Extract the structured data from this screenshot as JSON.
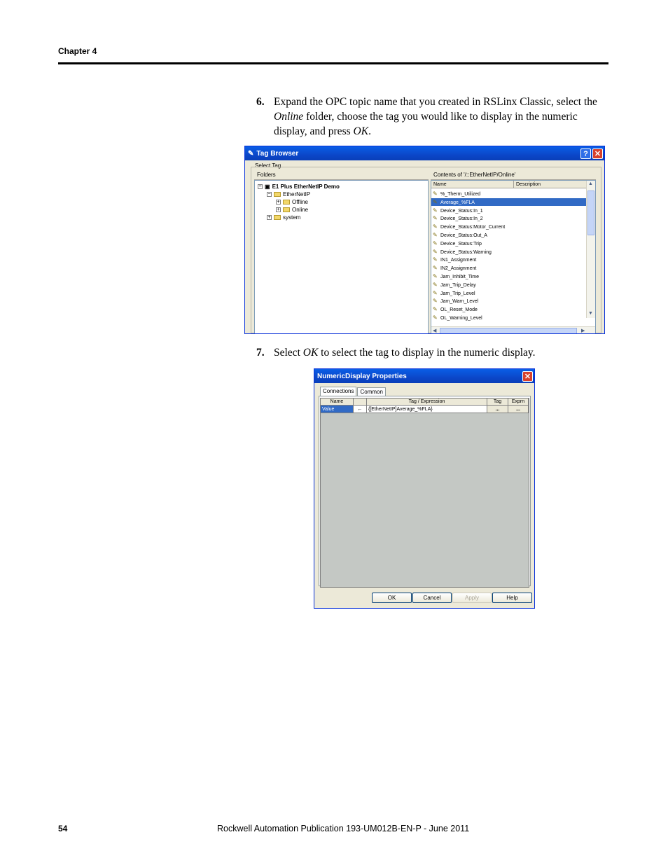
{
  "header": {
    "chapter": "Chapter 4"
  },
  "steps": [
    {
      "number": "6.",
      "text_parts": [
        "Expand the OPC topic name that you created in RSLinx Classic, select the ",
        "Online",
        " folder, choose the tag you would like to display in the numeric display, and press ",
        "OK",
        "."
      ]
    },
    {
      "number": "7.",
      "text_parts": [
        "Select ",
        "OK",
        " to select the tag to display in the numeric display."
      ]
    }
  ],
  "tag_browser": {
    "title": "Tag Browser",
    "help_label": "?",
    "close_label": "✕",
    "select_tag_label": "Select Tag",
    "folders_label": "Folders",
    "contents_label": "Contents of '/::EtherNetIP/Online'",
    "columns": [
      "Name",
      "Description"
    ],
    "tree": [
      {
        "label": "E1 Plus EtherNetIP Demo",
        "exp": "−"
      },
      {
        "label": "EtherNetIP",
        "exp": "−"
      },
      {
        "label": "Offline",
        "exp": "+"
      },
      {
        "label": "Online",
        "exp": "+"
      },
      {
        "label": "system",
        "exp": "+"
      }
    ],
    "tags": [
      "%_Therm_Utilized",
      "Average_%FLA",
      "Device_Status:In_1",
      "Device_Status:In_2",
      "Device_Status:Motor_Current",
      "Device_Status:Out_A",
      "Device_Status:Trip",
      "Device_Status:Warning",
      "IN1_Assignment",
      "IN2_Assignment",
      "Jam_Inhibit_Time",
      "Jam_Trip_Delay",
      "Jam_Trip_Level",
      "Jam_Warn_Level",
      "OL_Reset_Mode",
      "OL_Warning_Level"
    ],
    "selected_tag": "Average_%FLA"
  },
  "numeric_display": {
    "title": "NumericDisplay Properties",
    "close_label": "✕",
    "tabs": [
      "Connections",
      "Common"
    ],
    "columns": [
      "Name",
      "",
      "Tag / Expression",
      "Tag",
      "Exprn"
    ],
    "row": {
      "name": "Value",
      "arrow": "←",
      "expression": "{[EtherNetIP]Average_%FLA}",
      "tag_btn": "...",
      "exprn_btn": "..."
    },
    "buttons": {
      "ok": "OK",
      "cancel": "Cancel",
      "apply": "Apply",
      "help": "Help"
    }
  },
  "footer": {
    "page_number": "54",
    "publication": "Rockwell Automation Publication 193-UM012B-EN-P - June 2011"
  }
}
